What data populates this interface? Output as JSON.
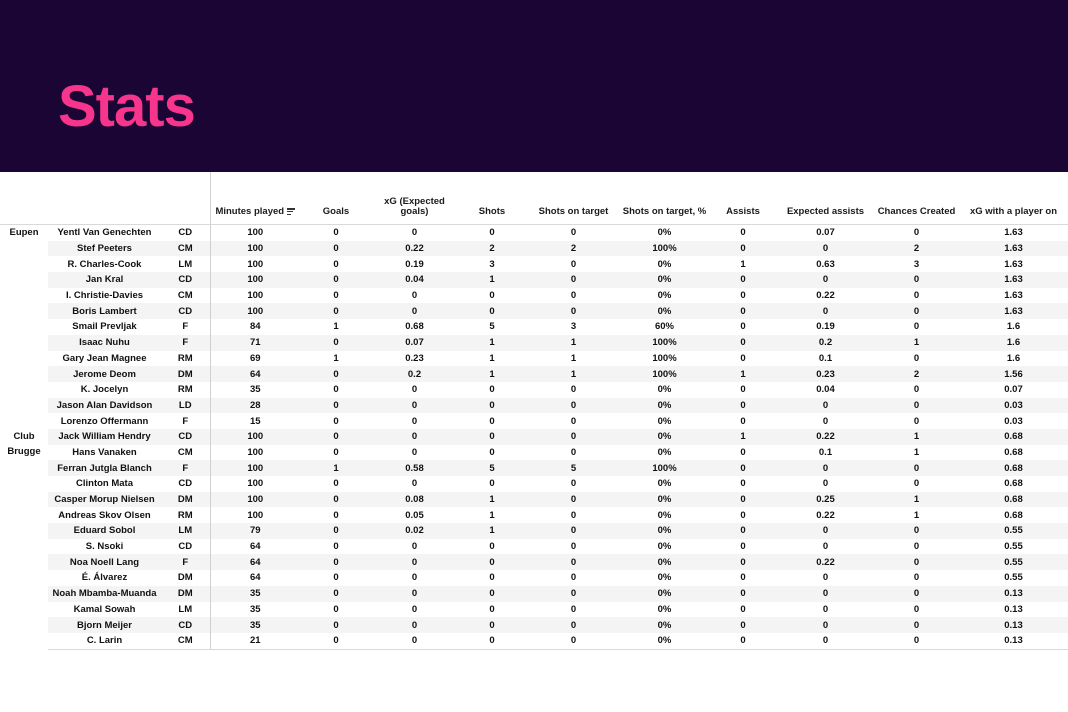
{
  "banner": {
    "title": "Stats",
    "background_color": "#1a0535",
    "title_color": "#f7358c"
  },
  "table": {
    "sort_icon": "sort-descending-icon",
    "sorted_column": "Minutes played",
    "columns": [
      {
        "key": "team",
        "label": ""
      },
      {
        "key": "player",
        "label": ""
      },
      {
        "key": "position",
        "label": ""
      },
      {
        "key": "minutes",
        "label": "Minutes played"
      },
      {
        "key": "goals",
        "label": "Goals"
      },
      {
        "key": "xg",
        "label": "xG (Expected goals)"
      },
      {
        "key": "shots",
        "label": "Shots"
      },
      {
        "key": "shots_on_target",
        "label": "Shots on target"
      },
      {
        "key": "sot_pct",
        "label": "Shots on target, %"
      },
      {
        "key": "assists",
        "label": "Assists"
      },
      {
        "key": "xa",
        "label": "Expected assists"
      },
      {
        "key": "chances",
        "label": "Chances Created"
      },
      {
        "key": "xg_player_on",
        "label": "xG with a player on"
      }
    ],
    "groups": [
      {
        "team": "Eupen",
        "rows": [
          {
            "player": "Yentl Van Genechten",
            "position": "CD",
            "minutes": "100",
            "goals": "0",
            "xg": "0",
            "shots": "0",
            "shots_on_target": "0",
            "sot_pct": "0%",
            "assists": "0",
            "xa": "0.07",
            "chances": "0",
            "xg_player_on": "1.63"
          },
          {
            "player": "Stef Peeters",
            "position": "CM",
            "minutes": "100",
            "goals": "0",
            "xg": "0.22",
            "shots": "2",
            "shots_on_target": "2",
            "sot_pct": "100%",
            "assists": "0",
            "xa": "0",
            "chances": "2",
            "xg_player_on": "1.63"
          },
          {
            "player": "R. Charles-Cook",
            "position": "LM",
            "minutes": "100",
            "goals": "0",
            "xg": "0.19",
            "shots": "3",
            "shots_on_target": "0",
            "sot_pct": "0%",
            "assists": "1",
            "xa": "0.63",
            "chances": "3",
            "xg_player_on": "1.63"
          },
          {
            "player": "Jan Kral",
            "position": "CD",
            "minutes": "100",
            "goals": "0",
            "xg": "0.04",
            "shots": "1",
            "shots_on_target": "0",
            "sot_pct": "0%",
            "assists": "0",
            "xa": "0",
            "chances": "0",
            "xg_player_on": "1.63"
          },
          {
            "player": "I. Christie-Davies",
            "position": "CM",
            "minutes": "100",
            "goals": "0",
            "xg": "0",
            "shots": "0",
            "shots_on_target": "0",
            "sot_pct": "0%",
            "assists": "0",
            "xa": "0.22",
            "chances": "0",
            "xg_player_on": "1.63"
          },
          {
            "player": "Boris Lambert",
            "position": "CD",
            "minutes": "100",
            "goals": "0",
            "xg": "0",
            "shots": "0",
            "shots_on_target": "0",
            "sot_pct": "0%",
            "assists": "0",
            "xa": "0",
            "chances": "0",
            "xg_player_on": "1.63"
          },
          {
            "player": "Smail Prevljak",
            "position": "F",
            "minutes": "84",
            "goals": "1",
            "xg": "0.68",
            "shots": "5",
            "shots_on_target": "3",
            "sot_pct": "60%",
            "assists": "0",
            "xa": "0.19",
            "chances": "0",
            "xg_player_on": "1.6"
          },
          {
            "player": "Isaac Nuhu",
            "position": "F",
            "minutes": "71",
            "goals": "0",
            "xg": "0.07",
            "shots": "1",
            "shots_on_target": "1",
            "sot_pct": "100%",
            "assists": "0",
            "xa": "0.2",
            "chances": "1",
            "xg_player_on": "1.6"
          },
          {
            "player": "Gary Jean Magnee",
            "position": "RM",
            "minutes": "69",
            "goals": "1",
            "xg": "0.23",
            "shots": "1",
            "shots_on_target": "1",
            "sot_pct": "100%",
            "assists": "0",
            "xa": "0.1",
            "chances": "0",
            "xg_player_on": "1.6"
          },
          {
            "player": "Jerome Deom",
            "position": "DM",
            "minutes": "64",
            "goals": "0",
            "xg": "0.2",
            "shots": "1",
            "shots_on_target": "1",
            "sot_pct": "100%",
            "assists": "1",
            "xa": "0.23",
            "chances": "2",
            "xg_player_on": "1.56"
          },
          {
            "player": "K. Jocelyn",
            "position": "RM",
            "minutes": "35",
            "goals": "0",
            "xg": "0",
            "shots": "0",
            "shots_on_target": "0",
            "sot_pct": "0%",
            "assists": "0",
            "xa": "0.04",
            "chances": "0",
            "xg_player_on": "0.07"
          },
          {
            "player": "Jason Alan Davidson",
            "position": "LD",
            "minutes": "28",
            "goals": "0",
            "xg": "0",
            "shots": "0",
            "shots_on_target": "0",
            "sot_pct": "0%",
            "assists": "0",
            "xa": "0",
            "chances": "0",
            "xg_player_on": "0.03"
          },
          {
            "player": "Lorenzo Offermann",
            "position": "F",
            "minutes": "15",
            "goals": "0",
            "xg": "0",
            "shots": "0",
            "shots_on_target": "0",
            "sot_pct": "0%",
            "assists": "0",
            "xa": "0",
            "chances": "0",
            "xg_player_on": "0.03"
          }
        ]
      },
      {
        "team": "Club Brugge",
        "team_line1": "Club",
        "team_line2": "Brugge",
        "rows": [
          {
            "player": "Jack William Hendry",
            "position": "CD",
            "minutes": "100",
            "goals": "0",
            "xg": "0",
            "shots": "0",
            "shots_on_target": "0",
            "sot_pct": "0%",
            "assists": "1",
            "xa": "0.22",
            "chances": "1",
            "xg_player_on": "0.68"
          },
          {
            "player": "Hans Vanaken",
            "position": "CM",
            "minutes": "100",
            "goals": "0",
            "xg": "0",
            "shots": "0",
            "shots_on_target": "0",
            "sot_pct": "0%",
            "assists": "0",
            "xa": "0.1",
            "chances": "1",
            "xg_player_on": "0.68"
          },
          {
            "player": "Ferran Jutgla Blanch",
            "position": "F",
            "minutes": "100",
            "goals": "1",
            "xg": "0.58",
            "shots": "5",
            "shots_on_target": "5",
            "sot_pct": "100%",
            "assists": "0",
            "xa": "0",
            "chances": "0",
            "xg_player_on": "0.68"
          },
          {
            "player": "Clinton Mata",
            "position": "CD",
            "minutes": "100",
            "goals": "0",
            "xg": "0",
            "shots": "0",
            "shots_on_target": "0",
            "sot_pct": "0%",
            "assists": "0",
            "xa": "0",
            "chances": "0",
            "xg_player_on": "0.68"
          },
          {
            "player": "Casper Morup Nielsen",
            "position": "DM",
            "minutes": "100",
            "goals": "0",
            "xg": "0.08",
            "shots": "1",
            "shots_on_target": "0",
            "sot_pct": "0%",
            "assists": "0",
            "xa": "0.25",
            "chances": "1",
            "xg_player_on": "0.68"
          },
          {
            "player": "Andreas Skov Olsen",
            "position": "RM",
            "minutes": "100",
            "goals": "0",
            "xg": "0.05",
            "shots": "1",
            "shots_on_target": "0",
            "sot_pct": "0%",
            "assists": "0",
            "xa": "0.22",
            "chances": "1",
            "xg_player_on": "0.68"
          },
          {
            "player": "Eduard Sobol",
            "position": "LM",
            "minutes": "79",
            "goals": "0",
            "xg": "0.02",
            "shots": "1",
            "shots_on_target": "0",
            "sot_pct": "0%",
            "assists": "0",
            "xa": "0",
            "chances": "0",
            "xg_player_on": "0.55"
          },
          {
            "player": "S. Nsoki",
            "position": "CD",
            "minutes": "64",
            "goals": "0",
            "xg": "0",
            "shots": "0",
            "shots_on_target": "0",
            "sot_pct": "0%",
            "assists": "0",
            "xa": "0",
            "chances": "0",
            "xg_player_on": "0.55"
          },
          {
            "player": "Noa Noell Lang",
            "position": "F",
            "minutes": "64",
            "goals": "0",
            "xg": "0",
            "shots": "0",
            "shots_on_target": "0",
            "sot_pct": "0%",
            "assists": "0",
            "xa": "0.22",
            "chances": "0",
            "xg_player_on": "0.55"
          },
          {
            "player": "É. Álvarez",
            "position": "DM",
            "minutes": "64",
            "goals": "0",
            "xg": "0",
            "shots": "0",
            "shots_on_target": "0",
            "sot_pct": "0%",
            "assists": "0",
            "xa": "0",
            "chances": "0",
            "xg_player_on": "0.55"
          },
          {
            "player": "Noah Mbamba-Muanda",
            "position": "DM",
            "minutes": "35",
            "goals": "0",
            "xg": "0",
            "shots": "0",
            "shots_on_target": "0",
            "sot_pct": "0%",
            "assists": "0",
            "xa": "0",
            "chances": "0",
            "xg_player_on": "0.13"
          },
          {
            "player": "Kamal Sowah",
            "position": "LM",
            "minutes": "35",
            "goals": "0",
            "xg": "0",
            "shots": "0",
            "shots_on_target": "0",
            "sot_pct": "0%",
            "assists": "0",
            "xa": "0",
            "chances": "0",
            "xg_player_on": "0.13"
          },
          {
            "player": "Bjorn Meijer",
            "position": "CD",
            "minutes": "35",
            "goals": "0",
            "xg": "0",
            "shots": "0",
            "shots_on_target": "0",
            "sot_pct": "0%",
            "assists": "0",
            "xa": "0",
            "chances": "0",
            "xg_player_on": "0.13"
          },
          {
            "player": "C. Larin",
            "position": "CM",
            "minutes": "21",
            "goals": "0",
            "xg": "0",
            "shots": "0",
            "shots_on_target": "0",
            "sot_pct": "0%",
            "assists": "0",
            "xa": "0",
            "chances": "0",
            "xg_player_on": "0.13"
          }
        ]
      }
    ]
  }
}
